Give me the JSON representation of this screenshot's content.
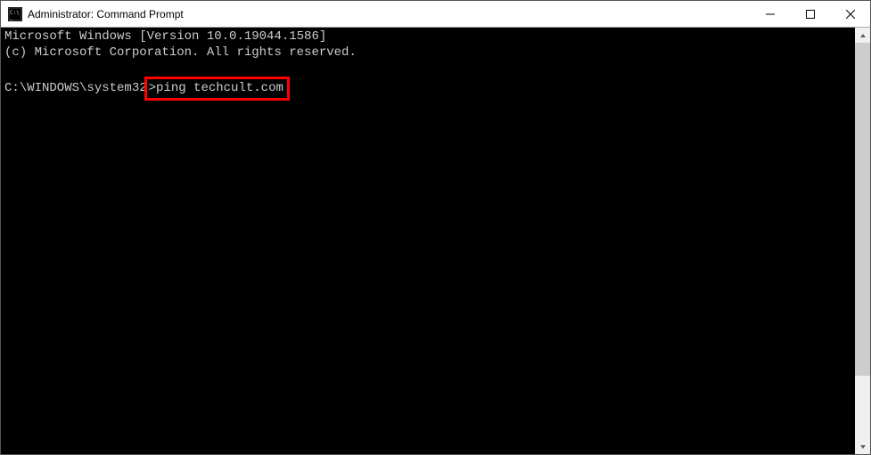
{
  "titlebar": {
    "title": "Administrator: Command Prompt"
  },
  "terminal": {
    "line1": "Microsoft Windows [Version 10.0.19044.1586]",
    "line2": "(c) Microsoft Corporation. All rights reserved.",
    "prompt": "C:\\WINDOWS\\system32",
    "prompt_sep": ">",
    "command": "ping techcult.com"
  },
  "highlight_color": "#ff0000"
}
